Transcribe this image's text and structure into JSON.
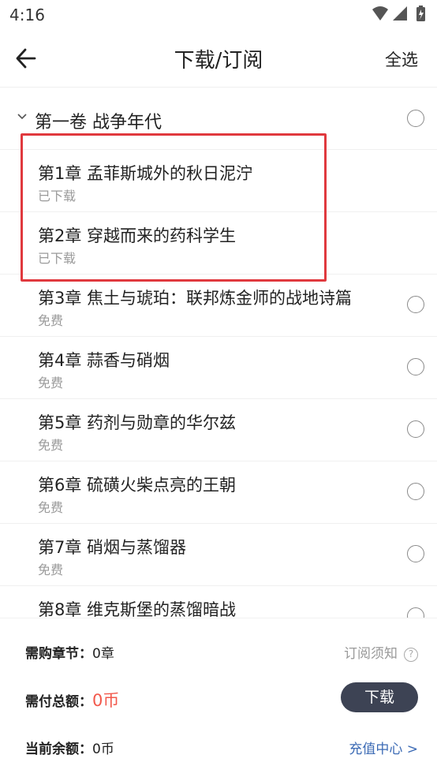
{
  "status_bar": {
    "time": "4:16"
  },
  "header": {
    "title": "下载/订阅",
    "select_all": "全选"
  },
  "volume": {
    "title": "第一卷 战争年代"
  },
  "chapters": [
    {
      "title": "第1章 孟菲斯城外的秋日泥泞",
      "status": "已下载"
    },
    {
      "title": "第2章 穿越而来的药科学生",
      "status": "已下载"
    },
    {
      "title": "第3章 焦土与琥珀：联邦炼金师的战地诗篇",
      "status": "免费"
    },
    {
      "title": "第4章 蒜香与硝烟",
      "status": "免费"
    },
    {
      "title": "第5章 药剂与勋章的华尔兹",
      "status": "免费"
    },
    {
      "title": "第6章 硫磺火柴点亮的王朝",
      "status": "免费"
    },
    {
      "title": "第7章 硝烟与蒸馏器",
      "status": "免费"
    },
    {
      "title": "第8章 维克斯堡的蒸馏暗战",
      "status": ""
    }
  ],
  "summary": {
    "chapters_label": "需购章节：",
    "chapters_value": "0章",
    "notice": "订阅须知",
    "total_label": "需付总额：",
    "total_value": "0币",
    "download": "下载",
    "balance_label": "当前余额：",
    "balance_value": "0币",
    "recharge": "充值中心 >"
  },
  "colors": {
    "accent_red": "#f2584b",
    "button_dark": "#3d4354",
    "link_blue": "#3c6bb5",
    "highlight_red": "#e0393e"
  }
}
